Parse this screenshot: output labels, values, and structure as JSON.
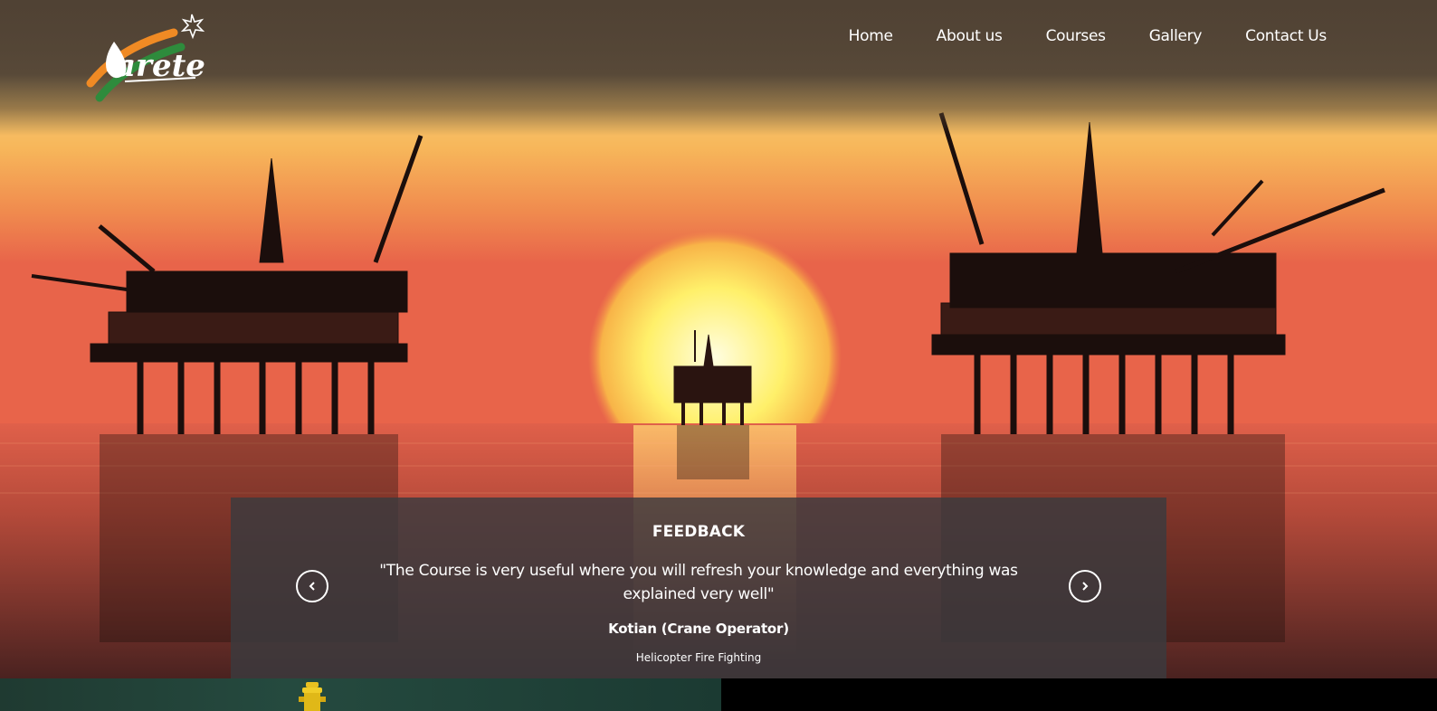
{
  "brand": {
    "logo_text": "arete",
    "colors": {
      "orange": "#f08a24",
      "green": "#2e8b3c",
      "white": "#ffffff"
    }
  },
  "nav": {
    "items": [
      {
        "label": "Home"
      },
      {
        "label": "About us"
      },
      {
        "label": "Courses"
      },
      {
        "label": "Gallery"
      },
      {
        "label": "Contact Us"
      }
    ]
  },
  "hero": {
    "description_icon": "oil-rigs-sunset-image"
  },
  "feedback": {
    "title": "FEEDBACK",
    "quote": "\"The Course is very useful where you will refresh your knowledge and everything was explained very well\"",
    "author": "Kotian (Crane Operator)",
    "course": "Helicopter Fire Fighting",
    "prev_icon": "chevron-left-icon",
    "next_icon": "chevron-right-icon"
  }
}
